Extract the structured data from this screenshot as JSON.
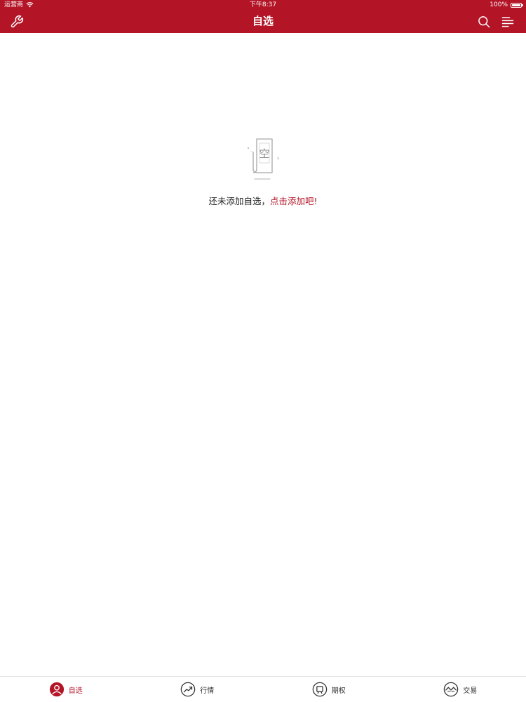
{
  "status_bar": {
    "carrier": "运营商",
    "time": "下午8:37",
    "battery": "100%",
    "battery_level": 1.0
  },
  "nav_bar": {
    "title": "自选",
    "left_icon": "wrench-icon",
    "right_icons": [
      "search-icon",
      "menu-icon"
    ]
  },
  "empty_state": {
    "illustration_char": "空",
    "message": "还未添加自选，",
    "action_text": "点击添加吧!"
  },
  "tab_bar": {
    "items": [
      {
        "label": "自选",
        "icon": "user-circle-icon",
        "active": true
      },
      {
        "label": "行情",
        "icon": "trend-icon",
        "active": false
      },
      {
        "label": "期权",
        "icon": "options-icon",
        "active": false
      },
      {
        "label": "交易",
        "icon": "exchange-icon",
        "active": false
      }
    ]
  },
  "colors": {
    "brand": "#b31527",
    "text": "#222222",
    "tab_inactive": "#333333",
    "divider": "#e2e2e2"
  }
}
